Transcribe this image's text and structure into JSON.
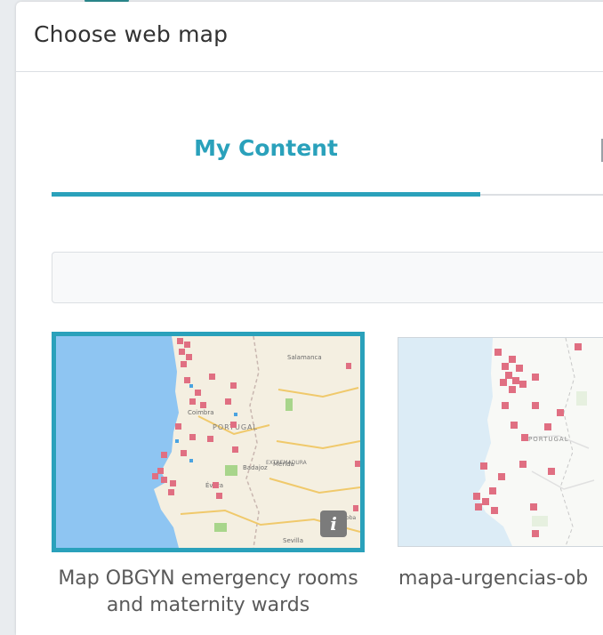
{
  "dialog": {
    "title": "Choose web map"
  },
  "tabs": [
    {
      "label": "My Content",
      "active": true
    }
  ],
  "search": {
    "value": "",
    "placeholder": ""
  },
  "cards": [
    {
      "title": "Map OBGYN emergency rooms and maternity wards",
      "selected": true,
      "info_icon": "info-icon",
      "map_labels": [
        "Salamanca",
        "Coimbra",
        "PORTUGAL",
        "Badajoz",
        "Mérida",
        "Évora",
        "Sevilla",
        "Córdoba",
        "EXTREMADURA"
      ]
    },
    {
      "title": "mapa-urgencias-ob",
      "selected": false,
      "map_labels": [
        "PORTUGAL"
      ]
    }
  ],
  "colors": {
    "accent": "#2aa1bb",
    "ocean": "#8ec5f2",
    "land": "#f4efe1",
    "marker": "#e06f82"
  }
}
